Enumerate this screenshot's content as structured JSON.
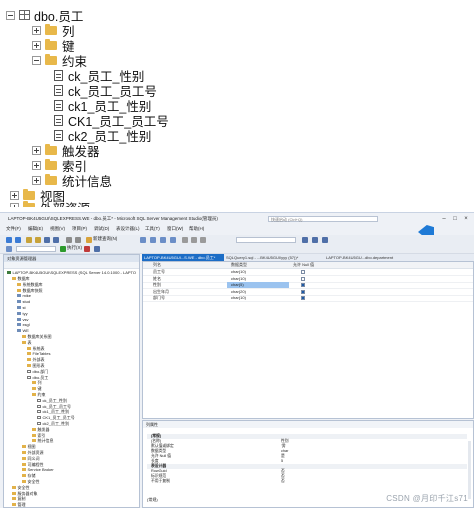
{
  "zoom_tree": {
    "table": "dbo.员工",
    "columns": "列",
    "keys": "键",
    "constraints": "约束",
    "constraint_items": [
      "ck_员工_性别",
      "ck_员工_员工号",
      "ck1_员工_性别",
      "CK1_员工_员工号",
      "ck2_员工_性别"
    ],
    "triggers": "触发器",
    "indexes": "索引",
    "statistics": "统计信息",
    "views": "视图",
    "external_resources": "外部资源"
  },
  "window": {
    "title": "LAPTOP-BK4U5GUI\\SQLEXPRESS.WE - dbo.员工* - Microsoft SQL Server Management Studio(管理员)",
    "quick_launch": "快速启动 (Ctrl+Q)",
    "menus": [
      "文件(F)",
      "编辑(E)",
      "视图(V)",
      "项目(P)",
      "调试(D)",
      "表设计器(L)",
      "工具(T)",
      "窗口(W)",
      "帮助(H)"
    ],
    "toolbar": {
      "new_query": "新建查询(N)",
      "execute": "执行(X)"
    }
  },
  "object_explorer": {
    "title": "对象资源管理器",
    "server": "LAPTOP-BK4U5GUI\\SQLEXPRESS (SQL Server 14.0.1000 - LAPTO",
    "rows": [
      {
        "text": "数据库",
        "indent": 1,
        "icon": "folder"
      },
      {
        "text": "系统数据库",
        "indent": 2,
        "icon": "folder"
      },
      {
        "text": "数据库快照",
        "indent": 2,
        "icon": "folder"
      },
      {
        "text": "mike",
        "indent": 2,
        "icon": "db"
      },
      {
        "text": "stud",
        "indent": 2,
        "icon": "db"
      },
      {
        "text": "st",
        "indent": 2,
        "icon": "db"
      },
      {
        "text": "tyy",
        "indent": 2,
        "icon": "db"
      },
      {
        "text": "vsv",
        "indent": 2,
        "icon": "db"
      },
      {
        "text": "xsgl",
        "indent": 2,
        "icon": "db"
      },
      {
        "text": "WE",
        "indent": 2,
        "icon": "db"
      },
      {
        "text": "数据库关系图",
        "indent": 3,
        "icon": "folder"
      },
      {
        "text": "表",
        "indent": 3,
        "icon": "folder"
      },
      {
        "text": "系统表",
        "indent": 4,
        "icon": "folder"
      },
      {
        "text": "FileTables",
        "indent": 4,
        "icon": "folder"
      },
      {
        "text": "外部表",
        "indent": 4,
        "icon": "folder"
      },
      {
        "text": "图形表",
        "indent": 4,
        "icon": "folder"
      },
      {
        "text": "dbo.部门",
        "indent": 4,
        "icon": "doc"
      },
      {
        "text": "dbo.员工",
        "indent": 4,
        "icon": "doc"
      },
      {
        "text": "列",
        "indent": 5,
        "icon": "folder"
      },
      {
        "text": "键",
        "indent": 5,
        "icon": "folder"
      },
      {
        "text": "约束",
        "indent": 5,
        "icon": "folder"
      },
      {
        "text": "ck_员工_性别",
        "indent": 6,
        "icon": "doc"
      },
      {
        "text": "ck_员工_员工号",
        "indent": 6,
        "icon": "doc"
      },
      {
        "text": "ck1_员工_性别",
        "indent": 6,
        "icon": "doc"
      },
      {
        "text": "CK1_员工_员工号",
        "indent": 6,
        "icon": "doc"
      },
      {
        "text": "ck2_员工_性别",
        "indent": 6,
        "icon": "doc"
      },
      {
        "text": "触发器",
        "indent": 5,
        "icon": "folder"
      },
      {
        "text": "索引",
        "indent": 5,
        "icon": "folder"
      },
      {
        "text": "统计信息",
        "indent": 5,
        "icon": "folder"
      },
      {
        "text": "视图",
        "indent": 3,
        "icon": "folder"
      },
      {
        "text": "外部资源",
        "indent": 3,
        "icon": "folder"
      },
      {
        "text": "同义词",
        "indent": 3,
        "icon": "folder"
      },
      {
        "text": "可编程性",
        "indent": 3,
        "icon": "folder"
      },
      {
        "text": "Service Broker",
        "indent": 3,
        "icon": "folder"
      },
      {
        "text": "存储",
        "indent": 3,
        "icon": "folder"
      },
      {
        "text": "安全性",
        "indent": 3,
        "icon": "folder"
      },
      {
        "text": "安全性",
        "indent": 1,
        "icon": "folder"
      },
      {
        "text": "服务器对象",
        "indent": 1,
        "icon": "folder"
      },
      {
        "text": "复制",
        "indent": 1,
        "icon": "folder"
      },
      {
        "text": "管理",
        "indent": 1,
        "icon": "folder"
      }
    ]
  },
  "tabs": [
    {
      "label": "LAPTOP-BK4U5GUI...S.WE - dbo.员工*",
      "active": true
    },
    {
      "label": "SQLQuery1.sql - ...BK4U5GUI\\yyy (57))*",
      "active": false
    },
    {
      "label": "LAPTOP-BK4U5GU...dbo.department",
      "active": false
    }
  ],
  "designer": {
    "headers": [
      "列名",
      "数据类型",
      "允许 Null 值"
    ],
    "rows": [
      {
        "name": "员工号",
        "type": "char(10)",
        "null": false,
        "selected": false
      },
      {
        "name": "姓名",
        "type": "char(10)",
        "null": false,
        "selected": false
      },
      {
        "name": "性别",
        "type": "char(5)",
        "null": true,
        "selected": true
      },
      {
        "name": "出生年月",
        "type": "char(20)",
        "null": true,
        "selected": false
      },
      {
        "name": "部门号",
        "type": "char(10)",
        "null": true,
        "selected": false
      }
    ]
  },
  "properties": {
    "tab_label": "列属性",
    "rows": [
      {
        "k": "(常规)",
        "v": "",
        "cat": true
      },
      {
        "k": "(名称)",
        "v": "性别",
        "cat": false
      },
      {
        "k": "默认值或绑定",
        "v": "'男'",
        "cat": false
      },
      {
        "k": "数据类型",
        "v": "char",
        "cat": false
      },
      {
        "k": "允许 Null 值",
        "v": "是",
        "cat": false
      },
      {
        "k": "长度",
        "v": "5",
        "cat": false
      },
      {
        "k": "表设计器",
        "v": "",
        "cat": true
      },
      {
        "k": "RowGuid",
        "v": "否",
        "cat": false
      },
      {
        "k": "标识规范",
        "v": "否",
        "cat": false
      },
      {
        "k": "不用于复制",
        "v": "否",
        "cat": false
      }
    ],
    "footer": "(常规)"
  },
  "watermark": "CSDN @月印千江s71"
}
